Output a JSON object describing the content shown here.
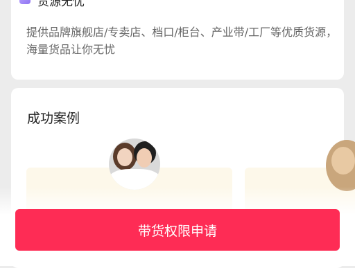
{
  "feature": {
    "title": "货源无忧",
    "description": "提供品牌旗舰店/专卖店、档口/柜台、产业带/工厂等优质货源，海量货品让你无忧",
    "icon": "box-icon",
    "icon_color": "#9a80f5"
  },
  "cases": {
    "title": "成功案例"
  },
  "apply_button": {
    "label": "带货权限申请",
    "color": "#fe2c55"
  }
}
